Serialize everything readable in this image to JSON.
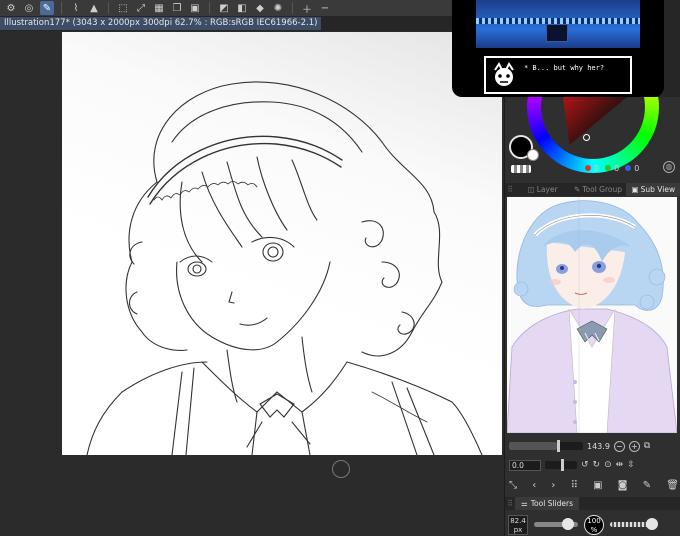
{
  "document": {
    "title": "Illustration177* (3043 x 2000px 300dpi 62.7% : RGB:sRGB IEC61966-2.1)"
  },
  "toolbar": {
    "icons": [
      "settings-icon",
      "undo-history-icon",
      "pen-icon",
      "lasso-icon",
      "fill-icon",
      "select-icon",
      "transform-icon",
      "ruler-icon",
      "copy-icon",
      "paste-icon",
      "layer-icon",
      "spray-icon",
      "flip-icon",
      "add-icon",
      "minus-icon",
      "more-icon"
    ]
  },
  "game_overlay": {
    "dialog_text": "* B... but why her?"
  },
  "color_panel": {
    "main_color": "#000000",
    "sub_color": "#ffffff",
    "rgb": [
      {
        "channel": "R",
        "value": "0",
        "color": "#e03030"
      },
      {
        "channel": "G",
        "value": "0",
        "color": "#30c030"
      },
      {
        "channel": "B",
        "value": "0",
        "color": "#3060e0"
      }
    ]
  },
  "tabs": [
    {
      "label": "Layer",
      "icon": "layer-icon",
      "active": false
    },
    {
      "label": "Tool Group",
      "icon": "tool-group-icon",
      "active": false
    },
    {
      "label": "Sub View",
      "icon": "sub-view-icon",
      "active": true
    }
  ],
  "navigator": {
    "zoom": "143.9",
    "rotation": "0.0"
  },
  "tool_sliders": {
    "label": "Tool Sliders",
    "brush_size": "82.4",
    "brush_unit": "px",
    "opacity": "100",
    "opacity_unit": "%"
  }
}
